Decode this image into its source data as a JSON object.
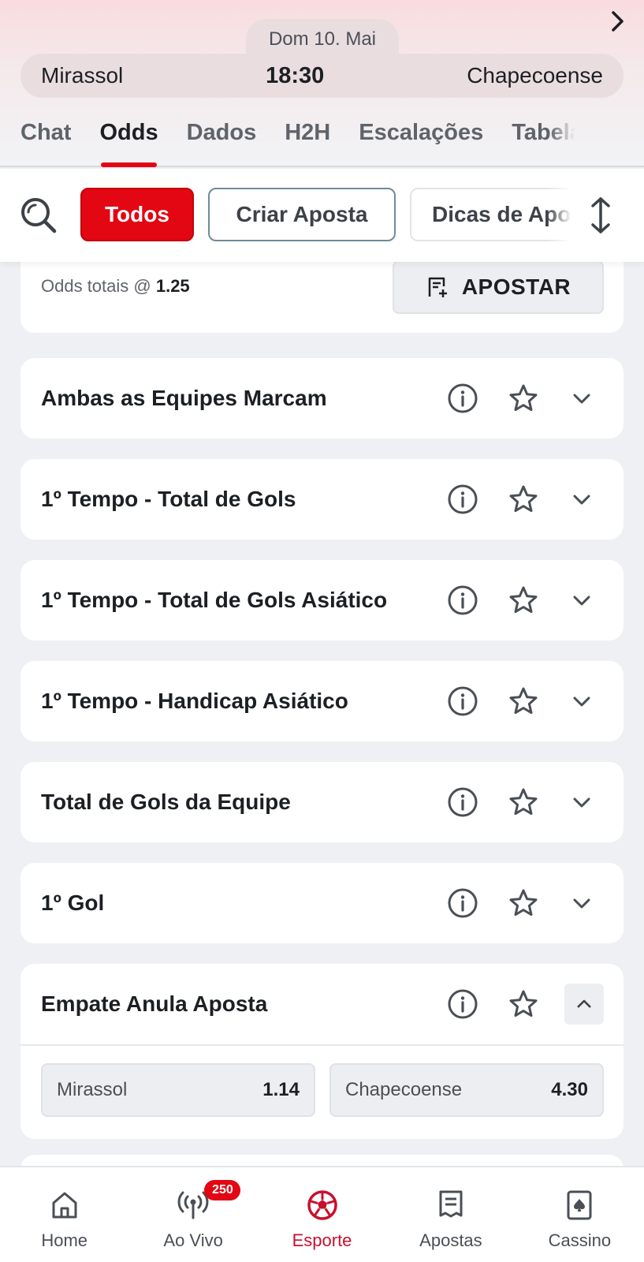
{
  "match": {
    "date": "Dom 10. Mai",
    "home_team": "Mirassol",
    "time": "18:30",
    "away_team": "Chapecoense"
  },
  "tabs": [
    {
      "label": "Chat",
      "active": false
    },
    {
      "label": "Odds",
      "active": true
    },
    {
      "label": "Dados",
      "active": false
    },
    {
      "label": "H2H",
      "active": false
    },
    {
      "label": "Escalações",
      "active": false
    },
    {
      "label": "Tabela",
      "active": false
    }
  ],
  "filters": {
    "todos": "Todos",
    "criar_aposta": "Criar Aposta",
    "dicas": "Dicas de Apostas"
  },
  "summary": {
    "odds_label": "Odds totais @ ",
    "odds_value": "1.25",
    "apostar_label": "APOSTAR"
  },
  "markets": [
    {
      "title": "Ambas as Equipes Marcam",
      "expanded": false
    },
    {
      "title": "1º Tempo - Total de Gols",
      "expanded": false
    },
    {
      "title": "1º Tempo - Total de Gols Asiático",
      "expanded": false
    },
    {
      "title": "1º Tempo - Handicap Asiático",
      "expanded": false
    },
    {
      "title": "Total de Gols da Equipe",
      "expanded": false
    },
    {
      "title": "1º Gol",
      "expanded": false
    },
    {
      "title": "Empate Anula Aposta",
      "expanded": true,
      "outcomes": [
        {
          "name": "Mirassol",
          "odd": "1.14"
        },
        {
          "name": "Chapecoense",
          "odd": "4.30"
        }
      ]
    }
  ],
  "bottom_nav": [
    {
      "label": "Home",
      "icon": "home-icon",
      "active": false
    },
    {
      "label": "Ao Vivo",
      "icon": "live-icon",
      "active": false,
      "badge": "250"
    },
    {
      "label": "Esporte",
      "icon": "soccer-ball-icon",
      "active": true
    },
    {
      "label": "Apostas",
      "icon": "bet-slip-icon",
      "active": false
    },
    {
      "label": "Cassino",
      "icon": "cards-icon",
      "active": false
    }
  ],
  "colors": {
    "accent": "#e30613",
    "nav_active": "#c8102e"
  }
}
